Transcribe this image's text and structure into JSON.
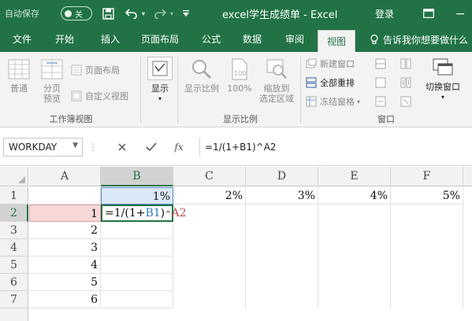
{
  "titlebar": {
    "autosave_label": "自动保存",
    "autosave_state": "关",
    "document_title": "excel学生成绩单 - Excel",
    "login_label": "登录"
  },
  "tabs": [
    {
      "label": "文件",
      "active": false
    },
    {
      "label": "开始",
      "active": false
    },
    {
      "label": "插入",
      "active": false
    },
    {
      "label": "页面布局",
      "active": false
    },
    {
      "label": "公式",
      "active": false
    },
    {
      "label": "数据",
      "active": false
    },
    {
      "label": "审阅",
      "active": false
    },
    {
      "label": "视图",
      "active": true
    }
  ],
  "tell_me": "告诉我你想要做什么",
  "ribbon": {
    "workbook_views": {
      "group_label": "工作簿视图",
      "normal": "普通",
      "page_break_1": "分页",
      "page_break_2": "预览",
      "page_layout": "页面布局",
      "custom_views": "自定义视图"
    },
    "show": {
      "label": "显示"
    },
    "zoom": {
      "group_label": "显示比例",
      "zoom": "显示比例",
      "zoom_100": "100%",
      "zoom_selection_1": "缩放到",
      "zoom_selection_2": "选定区域"
    },
    "window": {
      "group_label": "窗口",
      "new_window": "新建窗口",
      "arrange_all": "全部重排",
      "freeze_panes": "冻结窗格",
      "switch_windows": "切换窗口"
    }
  },
  "formula_bar": {
    "name_box": "WORKDAY",
    "formula": "=1/(1+B1)^A2"
  },
  "colors": {
    "accent": "#217346",
    "selected_row_fill": "#f8d7d7",
    "selected_ref_fill": "#dbe8f7",
    "ref_blue": "#2f7bbf",
    "ref_red": "#c0504d"
  },
  "grid": {
    "columns": [
      "A",
      "B",
      "C",
      "D",
      "E",
      "F"
    ],
    "rows": [
      "1",
      "2",
      "3",
      "4",
      "5",
      "6",
      "7"
    ],
    "cells": {
      "B1": "1%",
      "C1": "2%",
      "D1": "3%",
      "E1": "4%",
      "F1": "5%",
      "A2": "1",
      "A3": "2",
      "A4": "3",
      "A5": "4",
      "A6": "5",
      "A7": "6"
    },
    "edit_cell": {
      "prefix": "=1/(1+",
      "ref": "B1",
      "close": ")",
      "caret": "^",
      "ref2": "A2"
    }
  }
}
